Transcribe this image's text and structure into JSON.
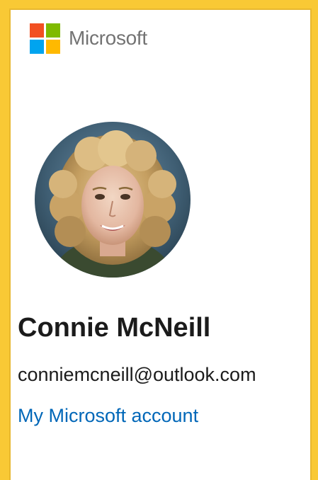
{
  "header": {
    "brand_name": "Microsoft",
    "logo_colors": {
      "red": "#F25022",
      "green": "#7FBA00",
      "blue": "#00A4EF",
      "yellow": "#FFB900"
    }
  },
  "account": {
    "avatar_icon": "profile-photo",
    "display_name": "Connie McNeill",
    "email": "conniemcneill@outlook.com",
    "manage_link_label": "My Microsoft account"
  },
  "theme": {
    "focus_border": "#F9C935",
    "link_color": "#0067B8",
    "text_color": "#1B1B1B",
    "brand_text_color": "#737373"
  }
}
